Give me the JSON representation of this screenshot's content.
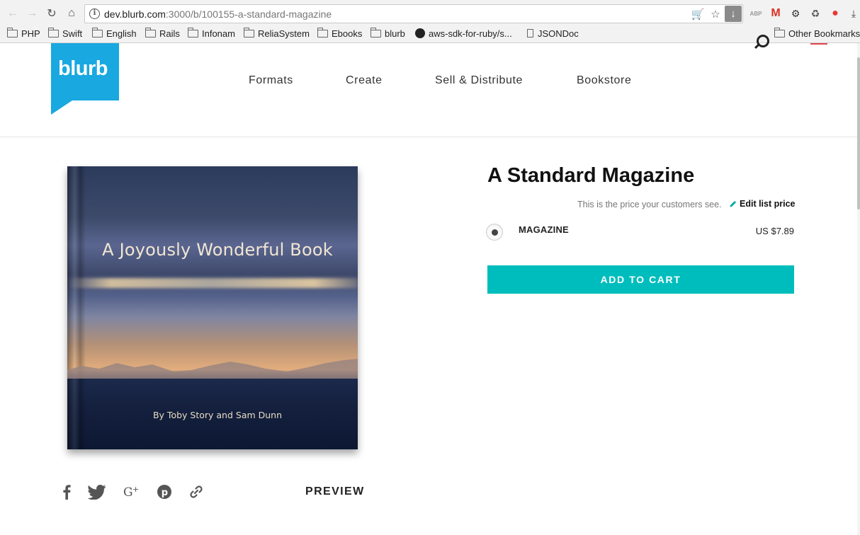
{
  "browser": {
    "url_host": "dev.blurb.com",
    "url_path": ":3000/b/100155-a-standard-magazine",
    "bookmarks": [
      "PHP",
      "Swift",
      "English",
      "Rails",
      "Infonam",
      "ReliaSystem",
      "Ebooks",
      "blurb",
      "aws-sdk-for-ruby/s...",
      "JSONDoc"
    ],
    "other_bookmarks": "Other Bookmarks"
  },
  "site": {
    "logo_text": "blurb",
    "nav": [
      "Formats",
      "Create",
      "Sell & Distribute",
      "Bookstore"
    ]
  },
  "book_cover": {
    "title": "A Joyously Wonderful Book",
    "author_line": "By Toby Story and Sam Dunn"
  },
  "share": {
    "icons": [
      "facebook-icon",
      "twitter-icon",
      "google-plus-icon",
      "pinterest-icon",
      "link-icon"
    ],
    "preview_label": "PREVIEW"
  },
  "product": {
    "title": "A Standard Magazine",
    "price_note": "This is the price your customers see.",
    "edit_price_label": "Edit list price",
    "format_name": "MAGAZINE",
    "format_price": "US $7.89",
    "add_to_cart_label": "ADD TO CART"
  },
  "colors": {
    "brand_blue": "#19a8e0",
    "cart_teal": "#00bdbd"
  }
}
